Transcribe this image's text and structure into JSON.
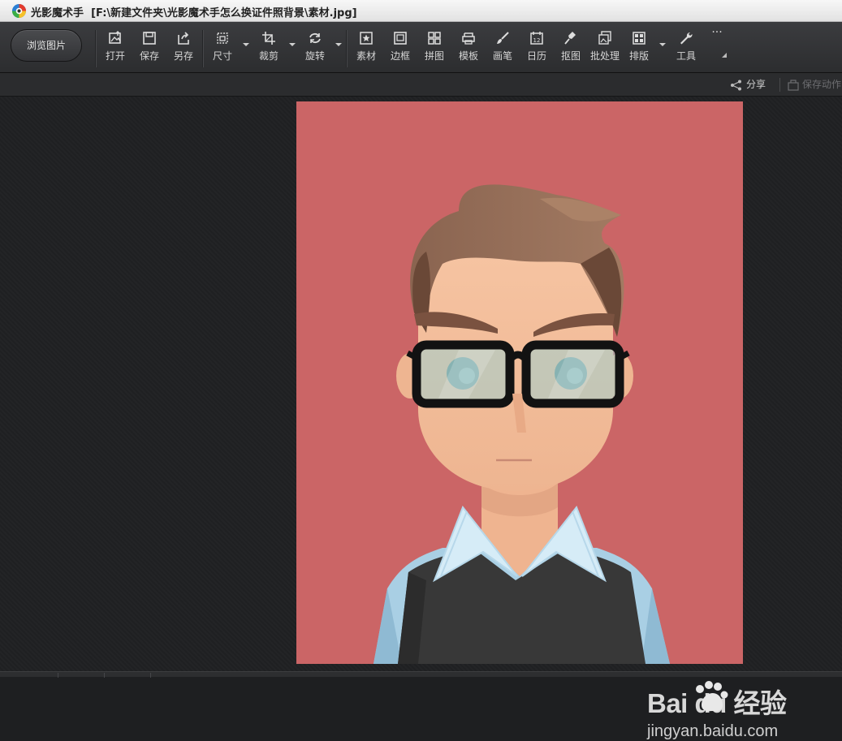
{
  "window": {
    "app_name": "光影魔术手",
    "file_path": "[F:\\新建文件夹\\光影魔术手怎么换证件照背景\\素材.jpg]"
  },
  "toolbar": {
    "browse_label": "浏览图片",
    "tools": [
      {
        "label": "打开",
        "icon": "open-image-icon"
      },
      {
        "label": "保存",
        "icon": "save-icon"
      },
      {
        "label": "另存",
        "icon": "save-as-icon"
      },
      {
        "label": "尺寸",
        "icon": "resize-icon"
      },
      {
        "label": "裁剪",
        "icon": "crop-icon"
      },
      {
        "label": "旋转",
        "icon": "rotate-icon"
      },
      {
        "label": "素材",
        "icon": "material-icon"
      },
      {
        "label": "边框",
        "icon": "border-icon"
      },
      {
        "label": "拼图",
        "icon": "collage-icon"
      },
      {
        "label": "模板",
        "icon": "template-icon"
      },
      {
        "label": "画笔",
        "icon": "brush-icon"
      },
      {
        "label": "日历",
        "icon": "calendar-icon"
      },
      {
        "label": "抠图",
        "icon": "cutout-icon"
      },
      {
        "label": "批处理",
        "icon": "batch-icon"
      },
      {
        "label": "排版",
        "icon": "layout-icon"
      },
      {
        "label": "工具",
        "icon": "wrench-icon"
      }
    ],
    "more_label": "···",
    "calendar_day": "12"
  },
  "subbar": {
    "share_label": "分享",
    "save_action_label": "保存动作"
  },
  "watermark": {
    "brand": "Bai du 经验",
    "url": "jingyan.baidu.com"
  },
  "colors": {
    "photo_background": "#cb6566",
    "toolbar": "#333437",
    "canvas": "#1f2022"
  }
}
